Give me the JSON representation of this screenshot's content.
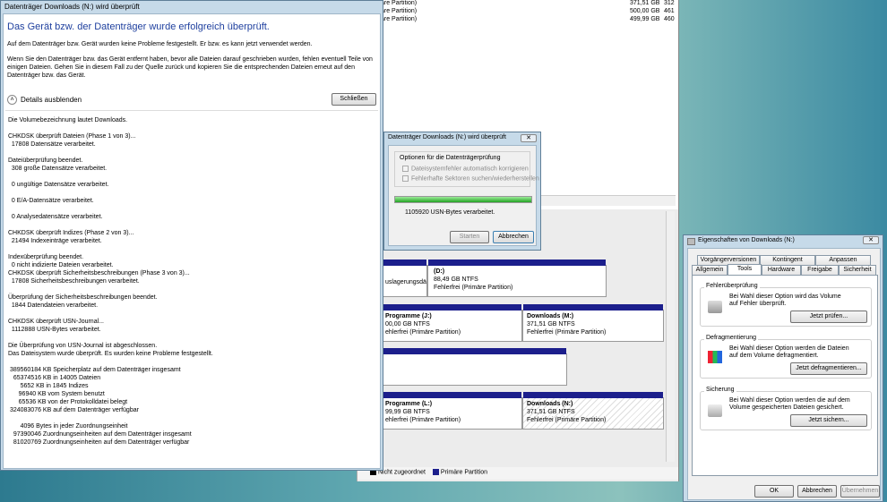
{
  "disk_mgmt": {
    "top_rows": [
      {
        "name": "are Partition)",
        "size": "371,51 GB",
        "free": "312"
      },
      {
        "name": "are Partition)",
        "size": "500,00 GB",
        "free": "461"
      },
      {
        "name": "are Partition)",
        "size": "499,99 GB",
        "free": "460"
      }
    ],
    "partitions": {
      "p_left1": {
        "line1": "uslagerungsdä"
      },
      "p_d": {
        "name": "(D:)",
        "size": "88,49 GB NTFS",
        "status": "Fehlerfrei (Primäre Partition)"
      },
      "p_j": {
        "name": "Programme (J:)",
        "size": "00,00 GB NTFS",
        "status": "ehlerfrei (Primäre Partition)"
      },
      "p_m": {
        "name": "Downloads (M:)",
        "size": "371,51 GB NTFS",
        "status": "Fehlerfrei (Primäre Partition)"
      },
      "p_l": {
        "name": "Programme (L:)",
        "size": "99,99 GB NTFS",
        "status": "ehlerfrei (Primäre Partition)"
      },
      "p_n": {
        "name": "Downloads (N:)",
        "size": "371,51 GB NTFS",
        "status": "Fehlerfrei (Primäre Partition)"
      }
    },
    "legend": {
      "unallocated": "Nicht zugeordnet",
      "primary": "Primäre Partition"
    },
    "colors": {
      "primary": "#1c1f8c",
      "unallocated": "#000000"
    }
  },
  "chkdsk": {
    "title": "Datenträger Downloads (N:) wird überprüft",
    "heading": "Das Gerät bzw. der Datenträger wurde erfolgreich überprüft.",
    "para1": "Auf dem Datenträger bzw. Gerät wurden keine Probleme festgestellt. Er bzw. es kann jetzt verwendet werden.",
    "para2": "Wenn Sie den Datenträger bzw. das Gerät entfernt haben, bevor alle Dateien darauf geschrieben wurden, fehlen eventuell Teile von einigen Dateien. Gehen Sie in diesem Fall zu der Quelle zurück und kopieren Sie die entsprechenden Dateien erneut auf den Datenträger bzw. das Gerät.",
    "details_toggle": "Details ausblenden",
    "close_button": "Schließen",
    "log": [
      "Die Volumebezeichnung lautet Downloads.",
      "",
      "CHKDSK überprüft Dateien (Phase 1 von 3)...",
      "  17808 Datensätze verarbeitet.",
      "",
      "Dateiüberprüfung beendet.",
      "  308 große Datensätze verarbeitet.",
      "",
      "  0 ungültige Datensätze verarbeitet.",
      "",
      "  0 E/A-Datensätze verarbeitet.",
      "",
      "  0 Analysedatensätze verarbeitet.",
      "",
      "CHKDSK überprüft Indizes (Phase 2 von 3)...",
      "  21494 Indexeinträge verarbeitet.",
      "",
      "Indexüberprüfung beendet.",
      "  0 nicht indizierte Dateien verarbeitet.",
      "CHKDSK überprüft Sicherheitsbeschreibungen (Phase 3 von 3)...",
      "  17808 Sicherheitsbeschreibungen verarbeitet.",
      "",
      "Überprüfung der Sicherheitsbeschreibungen beendet.",
      "  1844 Datendateien verarbeitet.",
      "",
      "CHKDSK überprüft USN-Journal...",
      "  1112888 USN-Bytes verarbeitet.",
      "",
      "Die Überprüfung von USN-Journal ist abgeschlossen.",
      "Das Dateisystem wurde überprüft. Es wurden keine Probleme festgestellt.",
      "",
      " 389560184 KB Speicherplatz auf dem Datenträger insgesamt",
      "   65374516 KB in 14005 Dateien",
      "       5652 KB in 1845 Indizes",
      "      96940 KB vom System benutzt",
      "      65536 KB von der Protokolldatei belegt",
      " 324083076 KB auf dem Datenträger verfügbar",
      "",
      "       4096 Bytes in jeder Zuordnungseinheit",
      "   97390046 Zuordnungseinheiten auf dem Datenträger insgesamt",
      "   81020769 Zuordnungseinheiten auf dem Datenträger verfügbar"
    ]
  },
  "progress_dialog": {
    "title": "Datenträger Downloads (N:) wird überprüft",
    "group_label": "Optionen für die Datenträgerprüfung",
    "option1": "Dateisystemfehler automatisch korrigieren",
    "option2": "Fehlerhafte Sektoren suchen/wiederherstellen",
    "status": "1105920 USN-Bytes verarbeitet.",
    "progress": 1.0,
    "start_button": "Starten",
    "cancel_button": "Abbrechen"
  },
  "properties": {
    "title": "Eigenschaften von Downloads (N:)",
    "tabs_row1": [
      "Vorgängerversionen",
      "Kontingent",
      "Anpassen"
    ],
    "tabs_row2": [
      "Allgemein",
      "Tools",
      "Hardware",
      "Freigabe",
      "Sicherheit"
    ],
    "groups": [
      {
        "label": "Fehlerüberprüfung",
        "text": "Bei Wahl dieser Option wird das Volume auf Fehler überprüft.",
        "button": "Jetzt prüfen..."
      },
      {
        "label": "Defragmentierung",
        "text": "Bei Wahl dieser Option werden die Dateien auf dem Volume defragmentiert.",
        "button": "Jetzt defragmentieren..."
      },
      {
        "label": "Sicherung",
        "text": "Bei Wahl dieser Option werden die auf dem Volume gespeicherten Dateien gesichert.",
        "button": "Jetzt sichern..."
      }
    ],
    "ok": "OK",
    "cancel": "Abbrechen",
    "apply": "Übernehmen"
  }
}
